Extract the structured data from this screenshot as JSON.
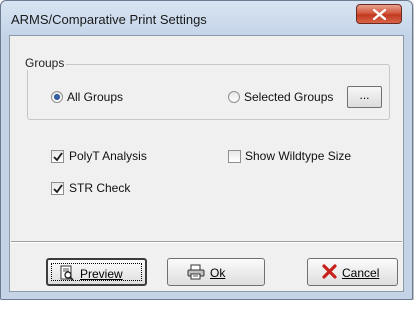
{
  "window": {
    "title": "ARMS/Comparative Print Settings"
  },
  "groups": {
    "label": "Groups",
    "all_groups": {
      "label": "All Groups",
      "selected": true
    },
    "selected_groups": {
      "label": "Selected Groups",
      "selected": false
    },
    "browse_label": "..."
  },
  "options": {
    "polyt": {
      "label": "PolyT Analysis",
      "checked": true
    },
    "wildtype": {
      "label": "Show Wildtype Size",
      "checked": false
    },
    "str": {
      "label": "STR Check",
      "checked": true
    }
  },
  "buttons": {
    "preview": {
      "label": "Preview",
      "icon": "print-preview-icon"
    },
    "ok": {
      "label": "Ok",
      "icon": "printer-icon"
    },
    "cancel": {
      "label": "Cancel",
      "icon": "red-x-icon"
    }
  },
  "colors": {
    "close_button": "#c94a2f",
    "cancel_x": "#c8201b",
    "accent_radio": "#2a5596"
  }
}
